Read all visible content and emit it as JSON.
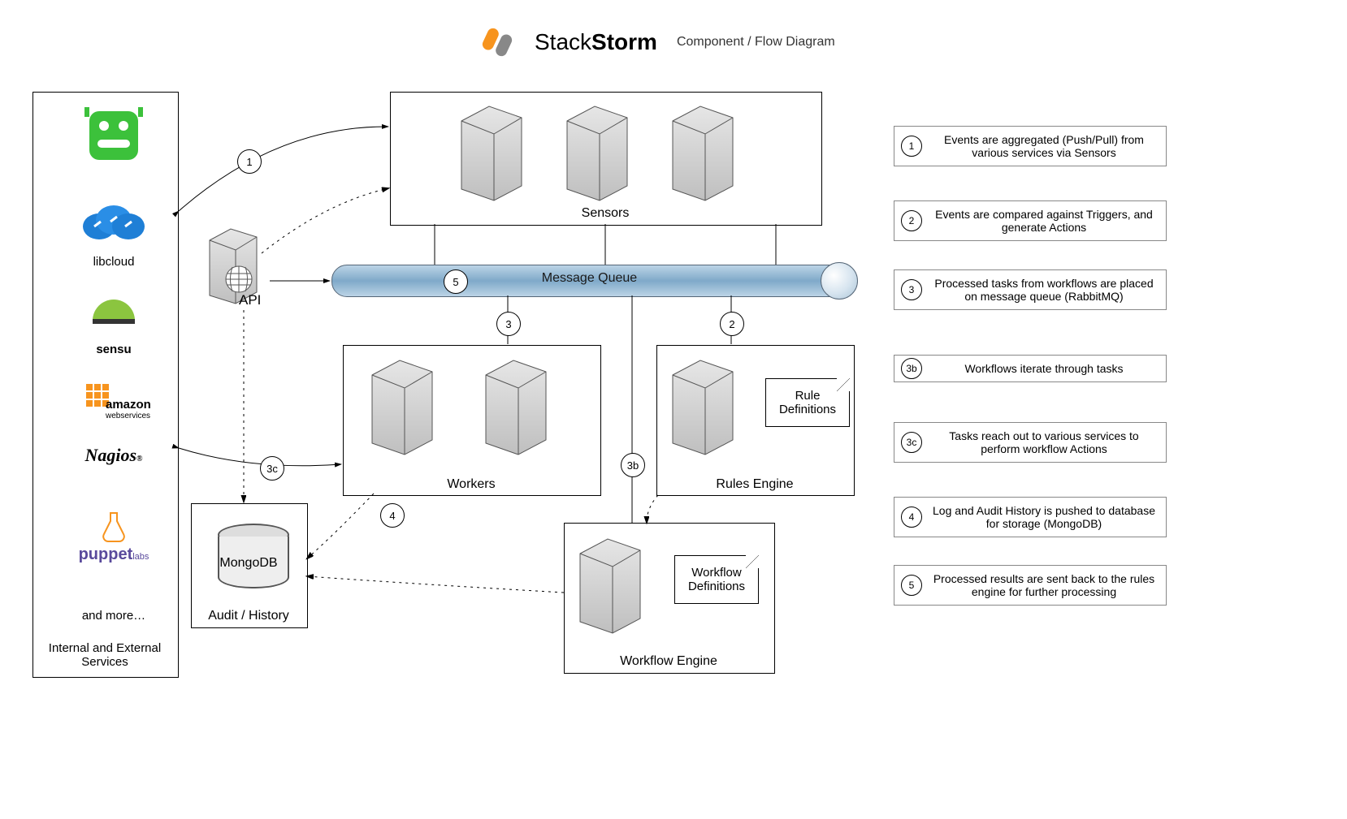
{
  "header": {
    "brand_light": "Stack",
    "brand_bold": "Storm",
    "subtitle": "Component / Flow Diagram"
  },
  "services": {
    "libcloud": "libcloud",
    "sensu": "sensu",
    "aws": "amazon",
    "aws_sub": "webservices",
    "nagios": "Nagios",
    "puppet": "puppet",
    "puppet_sub": "labs",
    "more": "and more…",
    "footer": "Internal and External Services"
  },
  "api": "API",
  "boxes": {
    "sensors": "Sensors",
    "workers": "Workers",
    "rules": "Rules Engine",
    "workflow": "Workflow Engine",
    "queue": "Message Queue",
    "mongo": "MongoDB",
    "audit": "Audit / History",
    "ruledefs": "Rule Definitions",
    "wfdefs": "Workflow Definitions"
  },
  "flow_badges": {
    "b1": "1",
    "b2": "2",
    "b3": "3",
    "b3b": "3b",
    "b3c": "3c",
    "b4": "4",
    "b5": "5"
  },
  "legend": [
    {
      "n": "1",
      "t": "Events are aggregated (Push/Pull) from various services via Sensors"
    },
    {
      "n": "2",
      "t": "Events are compared against Triggers, and generate Actions"
    },
    {
      "n": "3",
      "t": "Processed tasks from workflows are placed on message queue (RabbitMQ)"
    },
    {
      "n": "3b",
      "t": "Workflows iterate through tasks"
    },
    {
      "n": "3c",
      "t": "Tasks reach out to various services to perform workflow Actions"
    },
    {
      "n": "4",
      "t": "Log and Audit History is pushed to database for storage (MongoDB)"
    },
    {
      "n": "5",
      "t": "Processed results are sent back to the rules engine for further processing"
    }
  ]
}
